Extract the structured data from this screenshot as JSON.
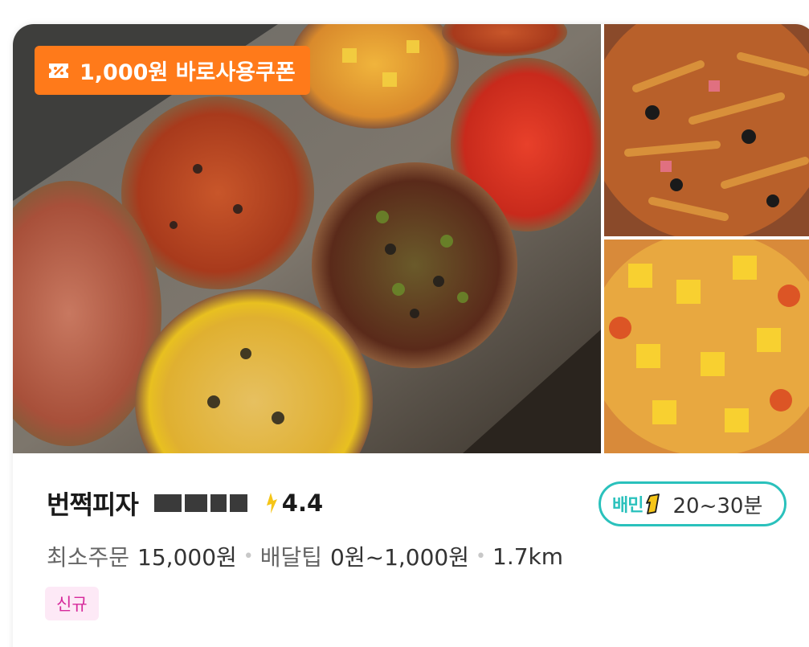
{
  "coupon": {
    "label": "1,000원 바로사용쿠폰",
    "color": "#ff7a1a",
    "icon": "coupon-ticket-icon"
  },
  "store": {
    "name": "번쩍피자",
    "rating": "4.4",
    "rating_icon": "lightning-star-icon"
  },
  "delivery": {
    "service_label": "배민",
    "service_icon": "baemin-one-icon",
    "time": "20~30분",
    "accent_color": "#2ac1bc"
  },
  "meta": {
    "min_order_label": "최소주문",
    "min_order_value": "15,000원",
    "tip_label": "배달팁",
    "tip_value": "0원~1,000원",
    "distance": "1.7km",
    "separator": "•"
  },
  "tag": {
    "label": "신규",
    "color": "#d6299b"
  }
}
